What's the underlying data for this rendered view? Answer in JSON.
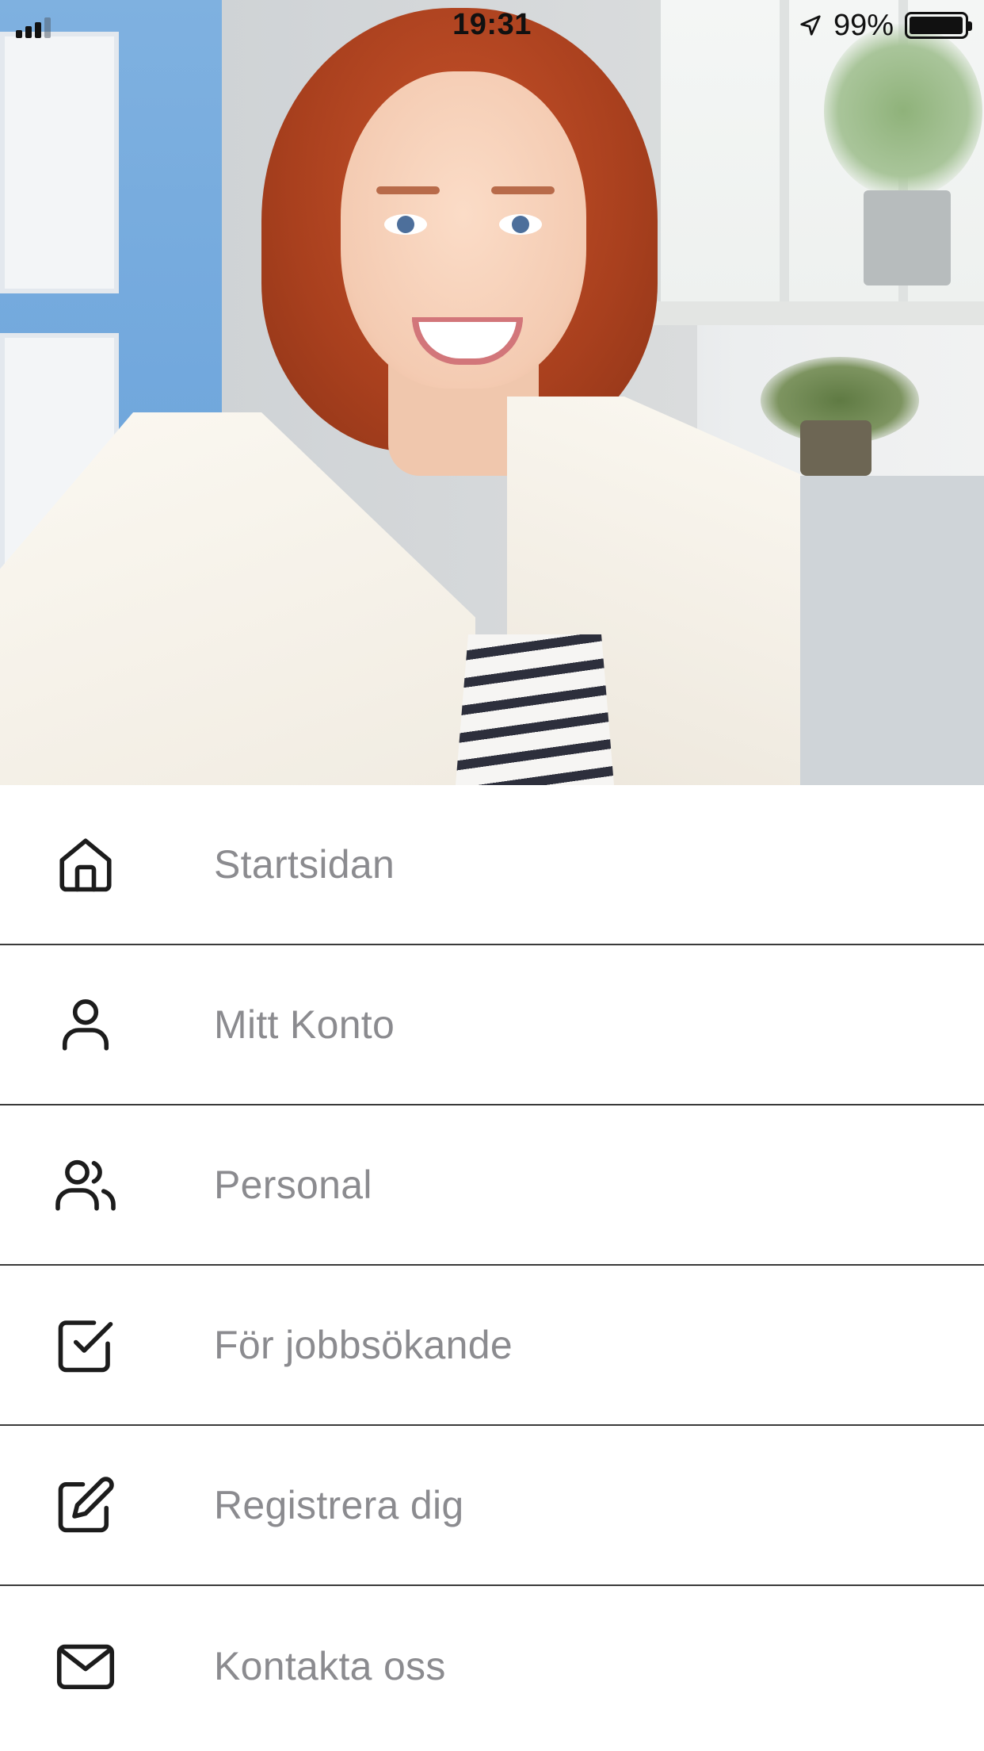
{
  "status_bar": {
    "time": "19:31",
    "battery_percent": "99%",
    "battery_level": 0.99,
    "signal_bars_active": 3,
    "signal_bars_total": 4
  },
  "hero_image": {
    "icon": "portrait-photo"
  },
  "menu": {
    "items": [
      {
        "label": "Startsidan",
        "icon": "home-icon"
      },
      {
        "label": "Mitt Konto",
        "icon": "user-icon"
      },
      {
        "label": "Personal",
        "icon": "users-icon"
      },
      {
        "label": "För jobbsökande",
        "icon": "checkbox-icon"
      },
      {
        "label": "Registrera dig",
        "icon": "edit-icon"
      },
      {
        "label": "Kontakta oss",
        "icon": "mail-icon"
      }
    ]
  },
  "colors": {
    "menu_text": "#8b8b8f",
    "divider": "#3a3a3a",
    "icon_stroke": "#1c1c1c",
    "background": "#ffffff"
  }
}
